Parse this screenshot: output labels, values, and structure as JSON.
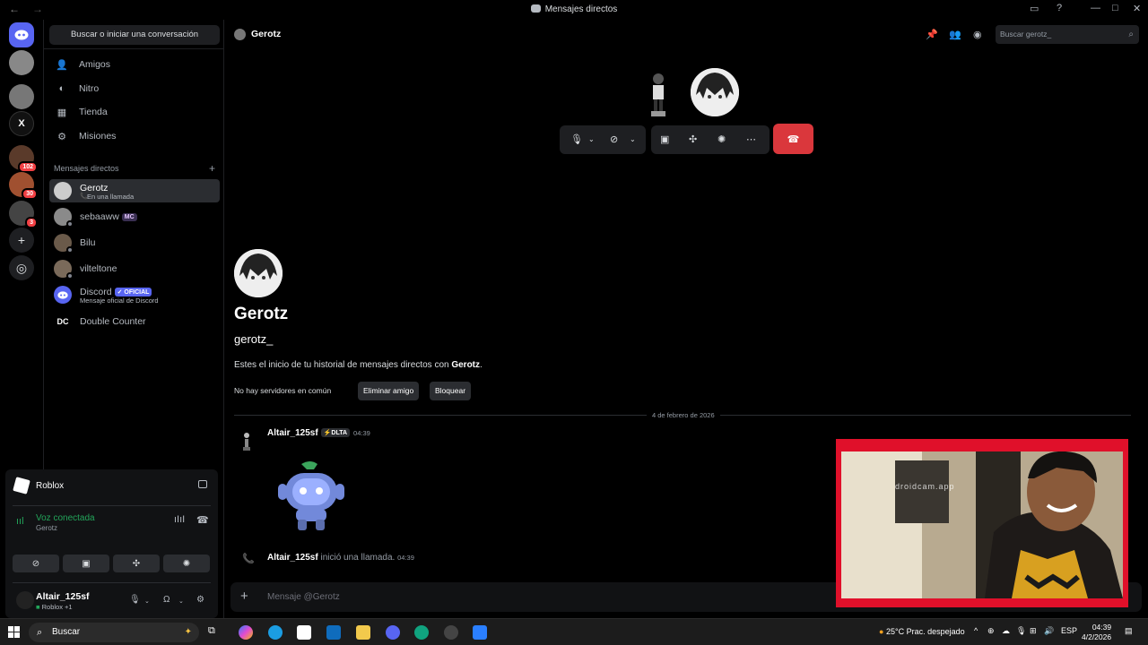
{
  "window": {
    "title": "Mensajes directos"
  },
  "guilds": {
    "badges": [
      "102",
      "30",
      "3"
    ],
    "x_label": "X"
  },
  "sidebar": {
    "search": "Buscar o iniciar una conversación",
    "nav": [
      {
        "label": "Amigos",
        "icon": "friends-icon"
      },
      {
        "label": "Nitro",
        "icon": "nitro-icon"
      },
      {
        "label": "Tienda",
        "icon": "shop-icon"
      },
      {
        "label": "Misiones",
        "icon": "quests-icon"
      }
    ],
    "dm_header": "Mensajes directos",
    "dms": [
      {
        "name": "Gerotz",
        "sub": "En una llamada"
      },
      {
        "name": "sebaaww",
        "tag": "MC"
      },
      {
        "name": "Bilu"
      },
      {
        "name": "vilteltone"
      },
      {
        "name": "Discord",
        "tag": "OFICIAL",
        "sub": "Mensaje oficial de Discord"
      },
      {
        "name": "Double Counter"
      }
    ]
  },
  "voice": {
    "game": "Roblox",
    "status": "Voz conectada",
    "channel": "Gerotz",
    "user": "Altair_125sf",
    "user_sub": "Roblox +1"
  },
  "header": {
    "name": "Gerotz",
    "search_placeholder": "Buscar gerotz_"
  },
  "profile": {
    "display_name": "Gerotz",
    "username": "gerotz_",
    "intro_prefix": "Estes el inicio de tu historial de mensajes directos con ",
    "intro_name": "Gerotz",
    "intro_suffix": ".",
    "no_servers": "No hay servidores en común",
    "remove_friend": "Eliminar amigo",
    "block": "Bloquear"
  },
  "messages": {
    "date": "4 de febrero de 2026",
    "author": "Altair_125sf",
    "author_tag": "DLTA",
    "time": "04:39",
    "call_author": "Altair_125sf",
    "call_text": " inició una llamada.",
    "call_time": "04:39"
  },
  "composer": {
    "placeholder": "Mensaje @Gerotz"
  },
  "camera": {
    "watermark": "droidcam.app"
  },
  "taskbar": {
    "search": "Buscar",
    "weather": "25°C  Prac. despejado",
    "lang": "ESP",
    "time": "04:39",
    "date": "4/2/2026"
  },
  "colors": {
    "accent": "#5865f2",
    "danger": "#da373c",
    "online": "#23a55a"
  }
}
